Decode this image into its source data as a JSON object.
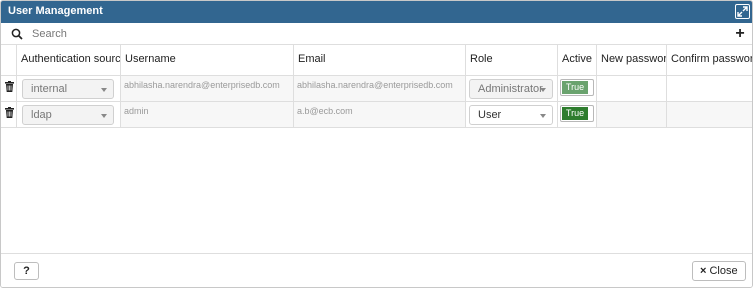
{
  "dialog": {
    "title": "User Management"
  },
  "toolbar": {
    "search_placeholder": "Search",
    "add_label": "+"
  },
  "table": {
    "columns": [
      "Authentication source",
      "Username",
      "Email",
      "Role",
      "Active",
      "New password",
      "Confirm password"
    ],
    "rows": [
      {
        "auth_source": "internal",
        "username": "abhilasha.narendra@enterprisedb.com",
        "email": "abhilasha.narendra@enterprisedb.com",
        "role": "Administrator",
        "active": "True",
        "new_password": "",
        "confirm_password": ""
      },
      {
        "auth_source": "ldap",
        "username": "admin",
        "email": "a.b@ecb.com",
        "role": "User",
        "active": "True",
        "new_password": "",
        "confirm_password": ""
      }
    ]
  },
  "footer": {
    "help_label": "?",
    "close_icon": "×",
    "close_label": "Close"
  },
  "colors": {
    "titlebar": "#326690",
    "active_toggle_light": "#6aa36e",
    "active_toggle_dark": "#2e7d2e"
  }
}
